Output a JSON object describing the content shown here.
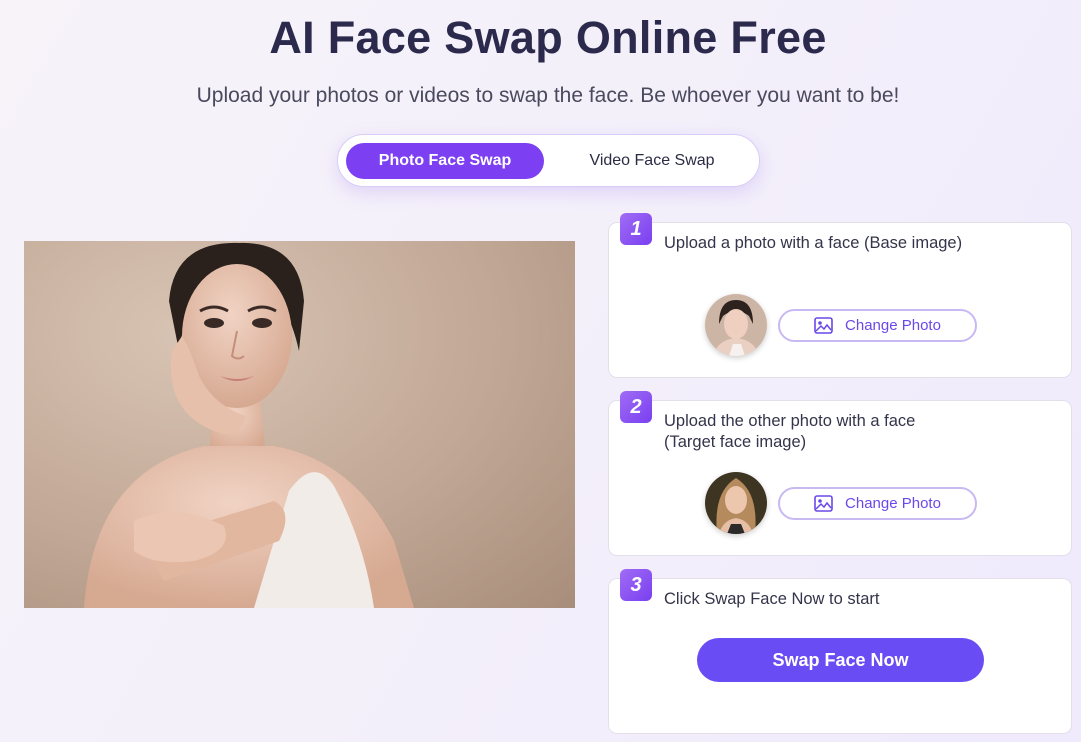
{
  "header": {
    "title": "AI Face Swap Online Free",
    "subtitle": "Upload your photos or videos to swap the face. Be whoever you want to be!"
  },
  "tabs": [
    {
      "label": "Photo Face Swap",
      "active": true
    },
    {
      "label": "Video Face Swap",
      "active": false
    }
  ],
  "steps": [
    {
      "number": "1",
      "text": "Upload a photo with a face (Base image)",
      "button_label": "Change Photo",
      "button_icon": "image-icon"
    },
    {
      "number": "2",
      "text": "Upload the other photo with a face (Target face image)",
      "button_label": "Change Photo",
      "button_icon": "image-icon"
    },
    {
      "number": "3",
      "text": "Click Swap Face Now to start",
      "button_label": "Swap Face Now"
    }
  ],
  "colors": {
    "accent": "#7c3ff2",
    "swap_button": "#6a4cf5",
    "outline_button_border": "#c9b9f3"
  }
}
